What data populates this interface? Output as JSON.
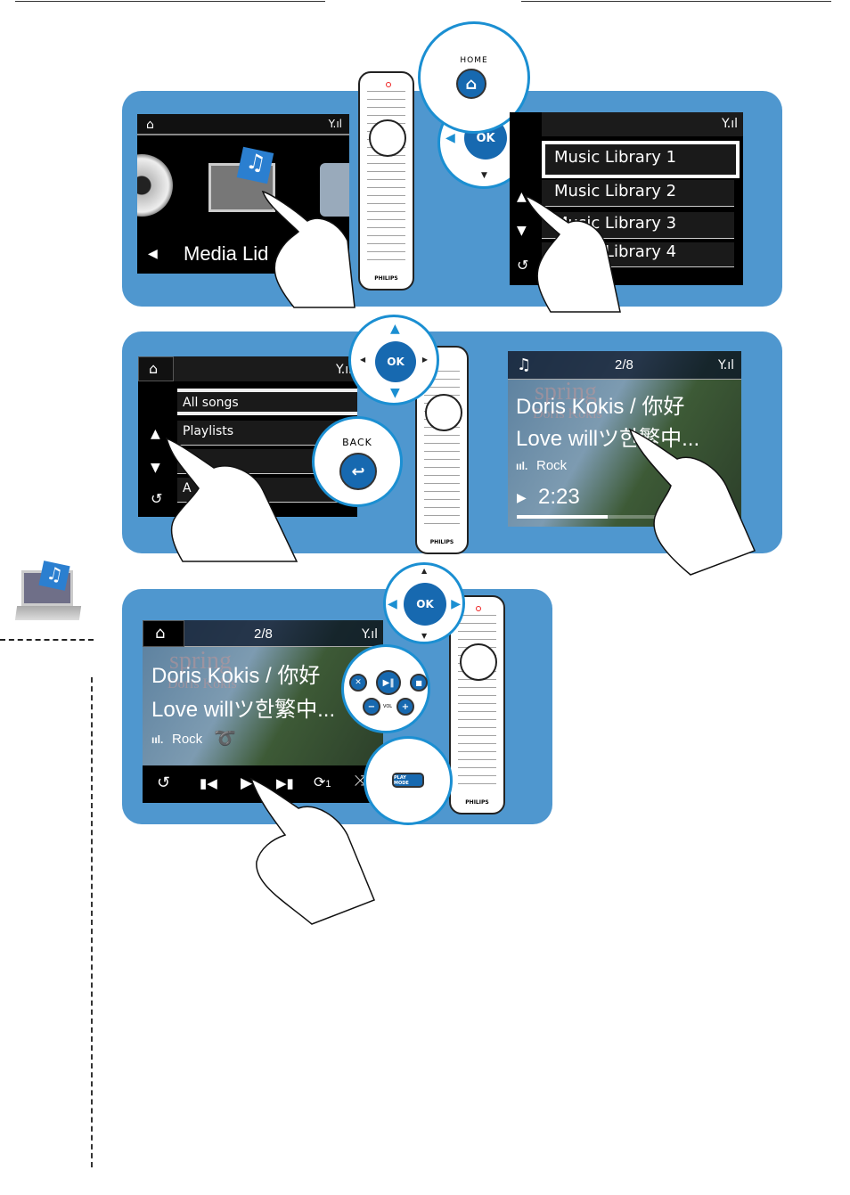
{
  "colors": {
    "panel": "#4f97cf",
    "callout_border": "#1b8fd2",
    "button": "#1769b0"
  },
  "step1": {
    "screen_media": {
      "icons": [
        "home-icon",
        "signal-icon",
        "left-arrow-icon"
      ],
      "label": "Media Lid"
    },
    "remote_brand": "PHILIPS",
    "home_callout": {
      "label": "HOME",
      "icon": "home-icon"
    },
    "ok_label": "OK",
    "library_screen": {
      "items": [
        "Music Library 1",
        "Music Library 2",
        "Music Library 3",
        "Music Library 4"
      ],
      "selected": 0
    }
  },
  "step2": {
    "list_screen": {
      "items": [
        "All songs",
        "Playlists",
        "",
        "A"
      ],
      "selected": 0
    },
    "ok_label": "OK",
    "back_callout": {
      "label": "BACK",
      "icon": "back-icon"
    },
    "remote_brand": "PHILIPS",
    "now_playing": {
      "track_index": "2/8",
      "artist_line": "Doris Kokis / 你好",
      "title_line": "Love willツ한繁中...",
      "genre": "Rock",
      "time": "2:23",
      "progress": 0.42,
      "album_text": "spring",
      "album_artist": "Doris Kokis"
    }
  },
  "step3": {
    "now_playing": {
      "track_index": "2/8",
      "artist_line": "Doris Kokis / 你好",
      "title_line": "Love willツ한繁中...",
      "genre": "Rock",
      "album_text": "spring",
      "album_artist": "Doris Kokis"
    },
    "controls": [
      "back-icon",
      "previous-icon",
      "play-icon",
      "next-icon",
      "repeat-one-icon",
      "shuffle-icon"
    ],
    "repeat_label": "1",
    "ok_label": "OK",
    "vol_label": "VOL",
    "playmode_label": "PLAY MODE",
    "remote_brand": "PHILIPS"
  }
}
